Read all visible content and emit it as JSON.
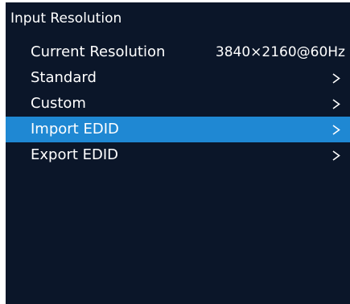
{
  "menu": {
    "title": "Input Resolution",
    "items": [
      {
        "label": "Current Resolution",
        "value": "3840×2160@60Hz",
        "has_submenu": false,
        "selected": false
      },
      {
        "label": "Standard",
        "value": "",
        "has_submenu": true,
        "selected": false
      },
      {
        "label": "Custom",
        "value": "",
        "has_submenu": true,
        "selected": false
      },
      {
        "label": "Import EDID",
        "value": "",
        "has_submenu": true,
        "selected": true
      },
      {
        "label": "Export EDID",
        "value": "",
        "has_submenu": true,
        "selected": false
      }
    ]
  },
  "icons": {
    "submenu": "chevron-right-icon"
  },
  "colors": {
    "background": "#0b1629",
    "highlight": "#1f88d3",
    "text": "#ffffff"
  }
}
